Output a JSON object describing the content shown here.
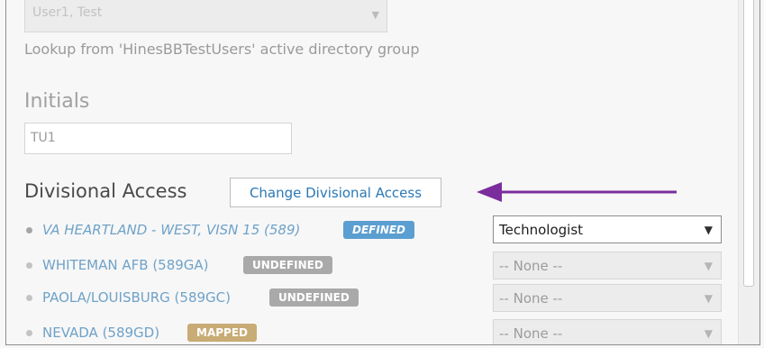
{
  "user_select": {
    "value": "User1, Test"
  },
  "lookup_text": "Lookup from 'HinesBBTestUsers' active directory group",
  "initials": {
    "label": "Initials",
    "value": "TU1"
  },
  "divisional_access": {
    "title": "Divisional Access",
    "change_button": "Change Divisional Access"
  },
  "divisions": [
    {
      "name": "VA HEARTLAND - WEST, VISN 15 (589)",
      "badge": "DEFINED",
      "role": "Technologist"
    },
    {
      "name": "WHITEMAN AFB (589GA)",
      "badge": "UNDEFINED",
      "role": "-- None --"
    },
    {
      "name": "PAOLA/LOUISBURG (589GC)",
      "badge": "UNDEFINED",
      "role": "-- None --"
    },
    {
      "name": "NEVADA (589GD)",
      "badge": "MAPPED",
      "role": "-- None --"
    }
  ],
  "icons": {
    "dropdown": "triangle-down-icon",
    "pointer": "left-arrow-icon",
    "bullet": "dot-icon"
  },
  "colors": {
    "link": "#6fa2c8",
    "defined_badge": "#5b9ed1",
    "undefined_badge": "#a9a9a9",
    "mapped_badge": "#c8ab75",
    "annotation_arrow": "#7b2d9e"
  }
}
